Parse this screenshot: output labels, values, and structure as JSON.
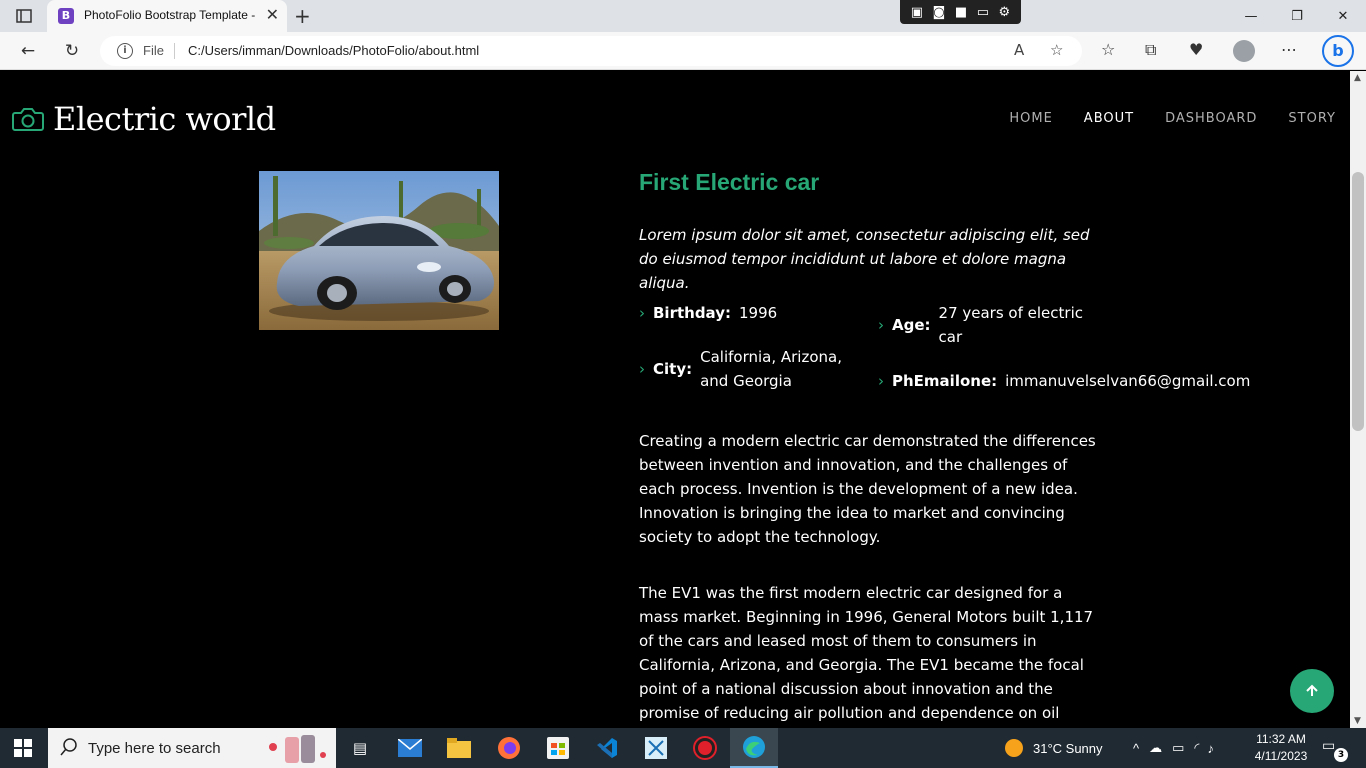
{
  "browser": {
    "tab_title": "PhotoFolio Bootstrap Template -",
    "tab_favicon_letter": "B",
    "file_label": "File",
    "url": "C:/Users/imman/Downloads/PhotoFolio/about.html"
  },
  "site": {
    "logo_text": "Electric world",
    "nav": [
      "HOME",
      "ABOUT",
      "DASHBOARD",
      "STORY"
    ],
    "active_nav": "ABOUT"
  },
  "about": {
    "title": "First Electric car",
    "intro": "Lorem ipsum dolor sit amet, consectetur adipiscing elit, sed do eiusmod tempor incididunt ut labore et dolore magna aliqua.",
    "details": {
      "birthday_label": "Birthday:",
      "birthday_value": "1996",
      "age_label": "Age:",
      "age_value_l1": "27 years of electric",
      "age_value_l2": "car",
      "city_label": "City:",
      "city_value_l1": "California, Arizona,",
      "city_value_l2": "and Georgia",
      "email_label": "PhEmailone:",
      "email_value": "immanuvelselvan66@gmail.com"
    },
    "para1": "Creating a modern electric car demonstrated the differences between invention and innovation, and the challenges of each process. Invention is the development of a new idea. Innovation is bringing the idea to market and convincing society to adopt the technology.",
    "para2": "The EV1 was the first modern electric car designed for a mass market. Beginning in 1996, General Motors built 1,117 of the cars and leased most of them to consumers in California, Arizona, and Georgia. The EV1 became the focal point of a national discussion about innovation and the promise of reducing air pollution and dependence on oil"
  },
  "taskbar": {
    "search_placeholder": "Type here to search",
    "weather": "31°C  Sunny",
    "time": "11:32 AM",
    "date": "4/11/2023",
    "notifications": "3"
  },
  "colors": {
    "accent": "#27a776",
    "page_bg": "#000000",
    "taskbar_bg": "#1f2a33"
  }
}
